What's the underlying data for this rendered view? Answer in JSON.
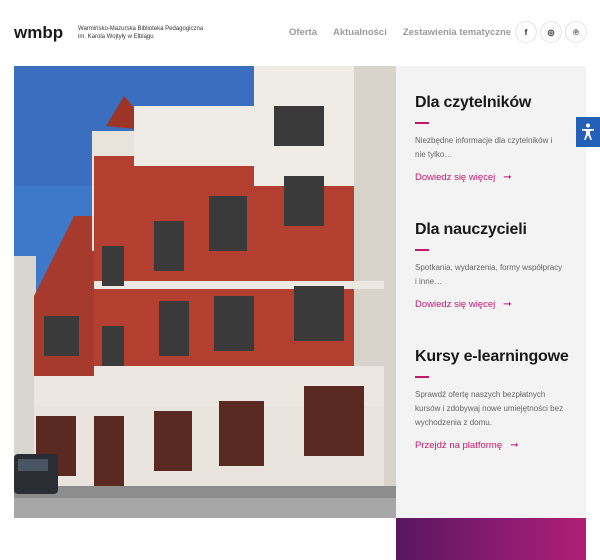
{
  "logo": {
    "mark": "wmbp",
    "line1": "Warmińsko-Mazurska Biblioteka Pedagogiczna",
    "line2": "im. Karola Wojtyły w Elblągu"
  },
  "nav": {
    "items": [
      "Oferta",
      "Aktualności",
      "Zestawienia tematyczne"
    ],
    "more": "⋮"
  },
  "social": {
    "facebook": "f",
    "instagram": "◎",
    "pinterest": "℗"
  },
  "cards": [
    {
      "title": "Dla czytelników",
      "desc": "Niezbędne informacje dla czytelników i nie tylko…",
      "link": "Dowiedz się więcej",
      "arrow": "➞"
    },
    {
      "title": "Dla nauczycieli",
      "desc": "Spotkania, wydarzenia, formy współpracy i inne…",
      "link": "Dowiedz się więcej",
      "arrow": "➞"
    },
    {
      "title": "Kursy e-learningowe",
      "desc": "Sprawdź ofertę naszych bezpłatnych kursów i zdobywaj nowe umiejętności bez wychodzenia z domu.",
      "link": "Przejdź na platformę",
      "arrow": "➞"
    }
  ],
  "colors": {
    "accent": "#c2186e",
    "a11y": "#2560b8",
    "brick": "#b03a2e",
    "sky": "#3d78c9"
  },
  "icons": {
    "accessibility": "accessibility-icon",
    "arrow": "arrow-right-icon"
  }
}
